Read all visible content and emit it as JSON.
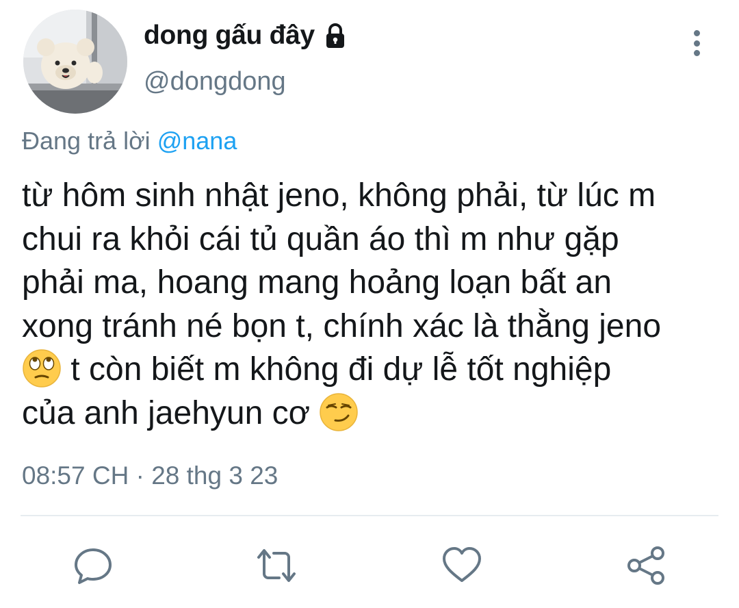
{
  "author": {
    "display_name": "dong gấu đây",
    "handle": "@dongdong",
    "avatar_icon": "teddy-bear-avatar",
    "protected_icon": "lock-icon"
  },
  "reply": {
    "prefix": "Đang trả lời",
    "mention": "@nana"
  },
  "tweet": {
    "lines": [
      "từ hôm sinh nhật jeno, không phải, từ lúc m",
      "chui ra khỏi cái tủ quần áo thì m như gặp",
      "phải ma, hoang mang hoảng loạn bất an",
      "xong tránh né bọn t, chính xác là thằng jeno",
      " t còn biết m không đi dự lễ tốt nghiệp",
      "của anh jaehyun cơ "
    ],
    "emojis": [
      "🙄",
      "😏"
    ]
  },
  "meta": {
    "time": "08:57 CH",
    "separator": "·",
    "date": "28 thg 3 23"
  },
  "actions": {
    "icons": [
      "reply-icon",
      "retweet-icon",
      "like-icon",
      "share-icon"
    ]
  },
  "colors": {
    "text": "#14171a",
    "secondary": "#657786",
    "mention": "#1da1f2",
    "divider": "#e6ecf0"
  }
}
